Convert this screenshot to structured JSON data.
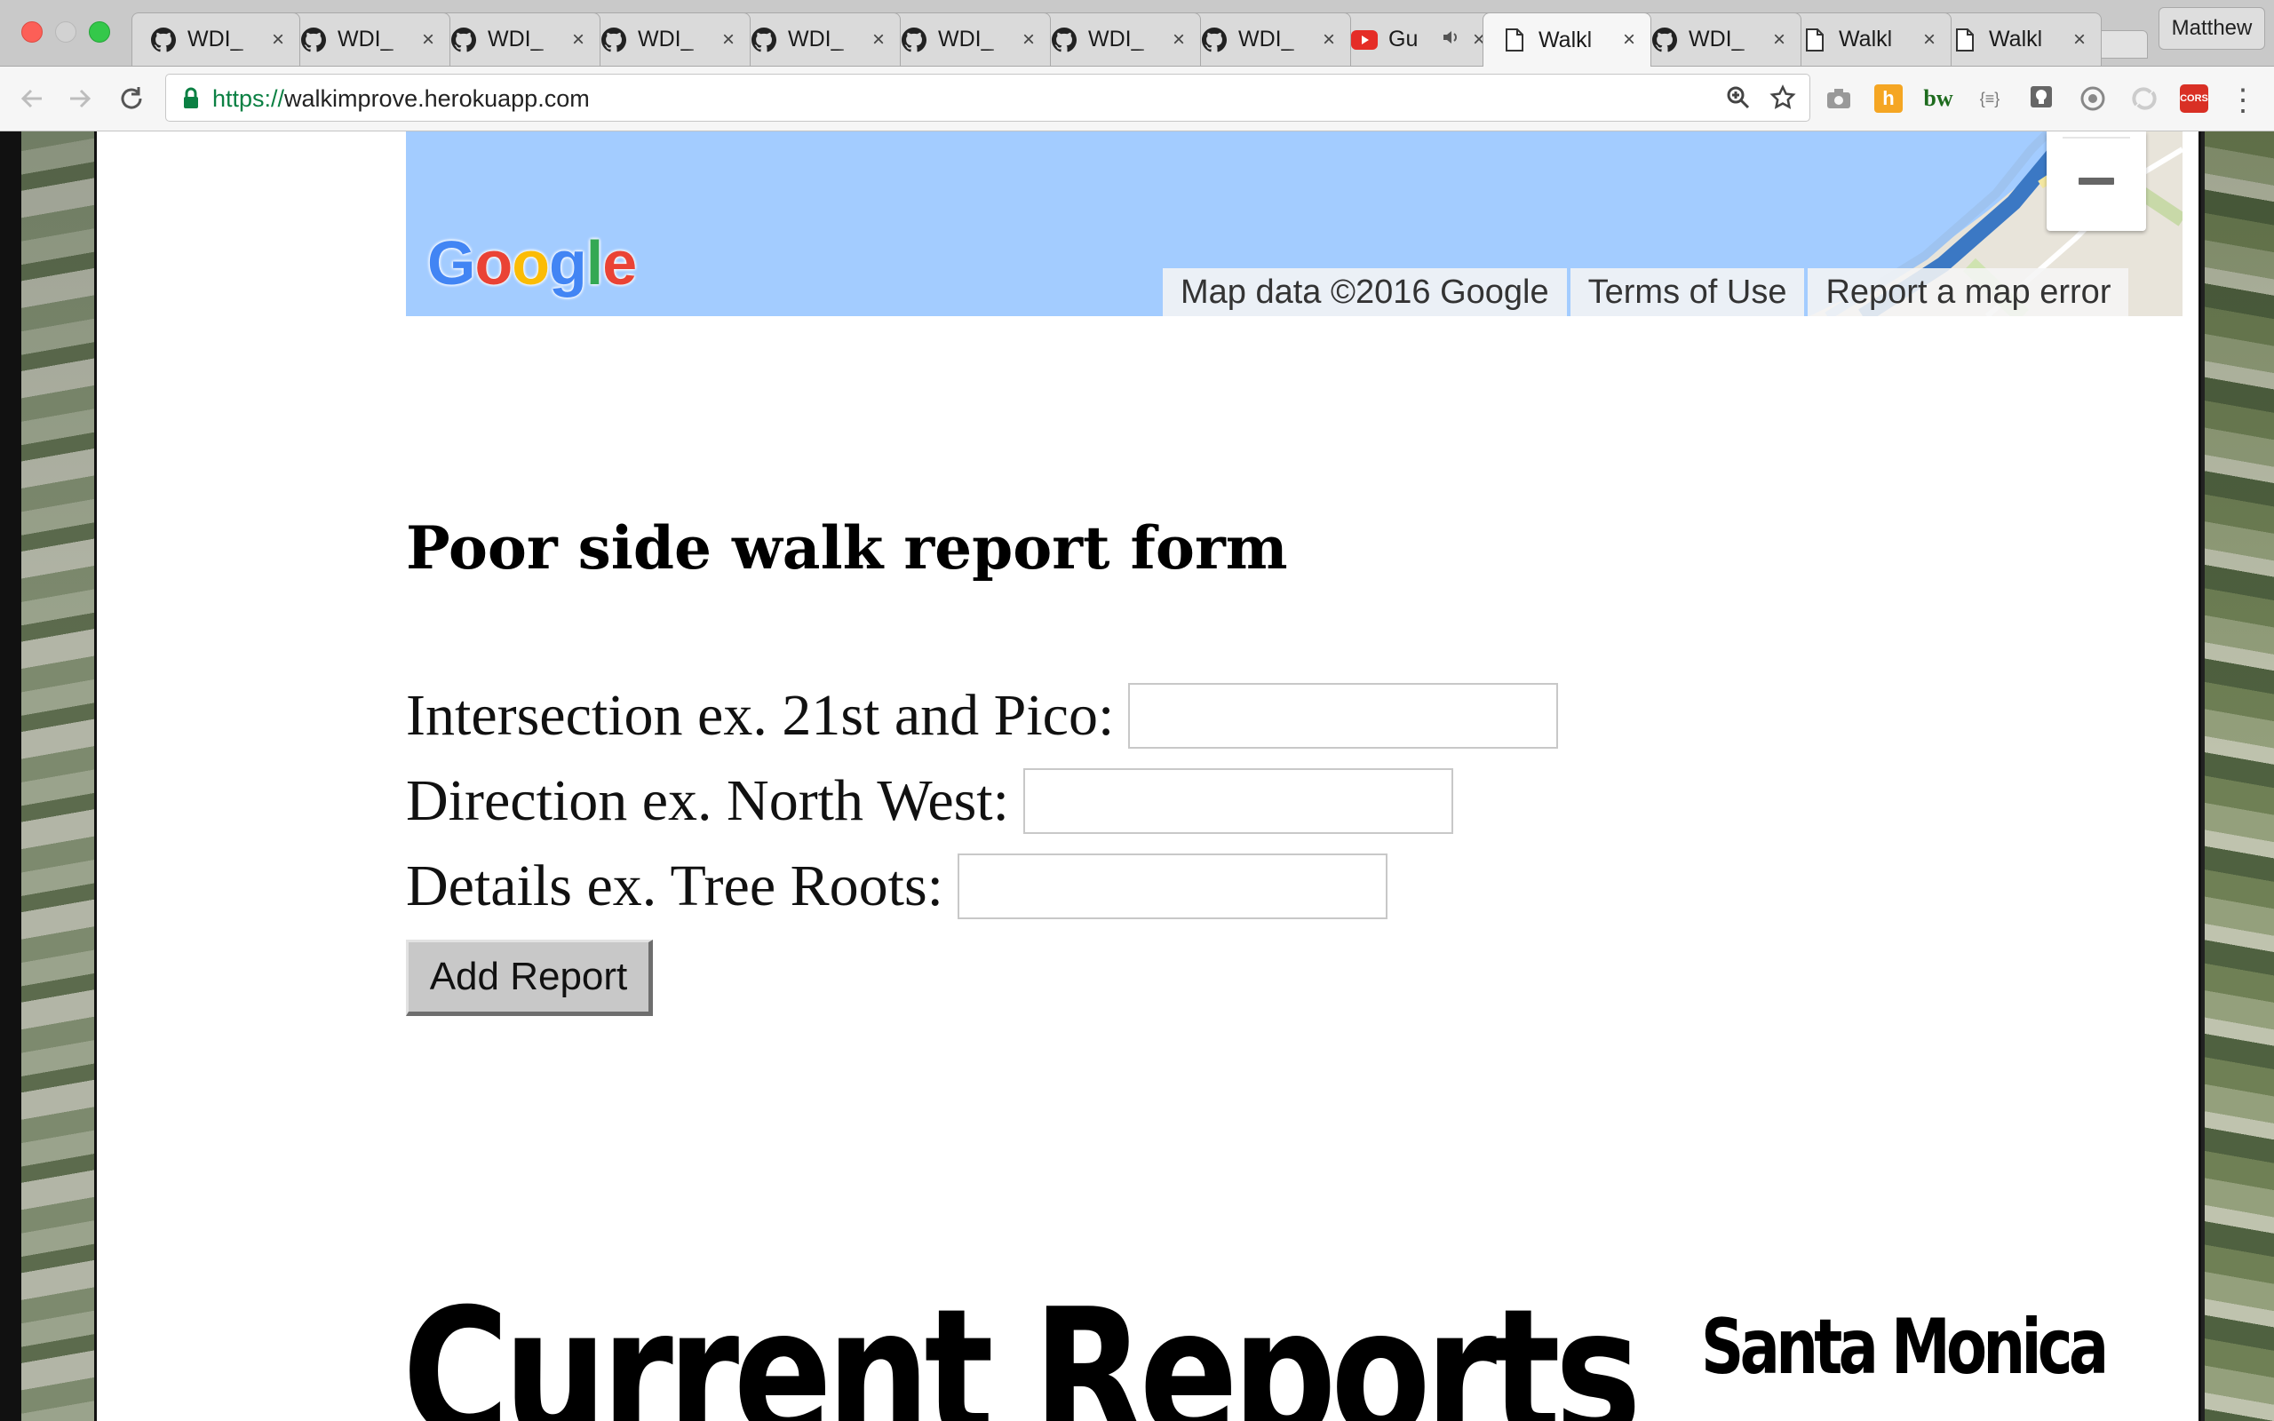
{
  "browser": {
    "tabs": [
      {
        "title": "WDI_",
        "icon": "github-icon",
        "active": false
      },
      {
        "title": "WDI_",
        "icon": "github-icon",
        "active": false
      },
      {
        "title": "WDI_",
        "icon": "github-icon",
        "active": false
      },
      {
        "title": "WDI_",
        "icon": "github-icon",
        "active": false
      },
      {
        "title": "WDI_",
        "icon": "github-icon",
        "active": false
      },
      {
        "title": "WDI_",
        "icon": "github-icon",
        "active": false
      },
      {
        "title": "WDI_",
        "icon": "github-icon",
        "active": false
      },
      {
        "title": "WDI_",
        "icon": "github-icon",
        "active": false
      },
      {
        "title": "Gu",
        "icon": "youtube-icon",
        "active": false,
        "audio": true
      },
      {
        "title": "Walkl",
        "icon": "page-icon",
        "active": true
      },
      {
        "title": "WDI_",
        "icon": "github-icon",
        "active": false
      },
      {
        "title": "Walkl",
        "icon": "page-icon",
        "active": false
      },
      {
        "title": "Walkl",
        "icon": "page-icon",
        "active": false
      }
    ],
    "profile_name": "Matthew",
    "url_scheme": "https://",
    "url_host": "walkimprove.herokuapp.com",
    "tab_close_glyph": "×"
  },
  "map": {
    "logo_letters": [
      "G",
      "o",
      "o",
      "g",
      "l",
      "e"
    ],
    "logo_colors": [
      "#4285f4",
      "#ea4335",
      "#fbbc05",
      "#4285f4",
      "#34a853",
      "#ea4335"
    ],
    "attribution": {
      "map_data": "Map data ©2016 Google",
      "terms": "Terms of Use",
      "report_error": "Report a map error"
    },
    "water_color": "#a3ccff"
  },
  "form": {
    "title": "Poor side walk report form",
    "fields": {
      "intersection_label": "Intersection ex. 21st and Pico:",
      "direction_label": "Direction ex. North West:",
      "details_label": "Details ex. Tree Roots:"
    },
    "submit_label": "Add Report"
  },
  "reports": {
    "title": "Current Reports",
    "subtitle": "Santa Monica"
  }
}
